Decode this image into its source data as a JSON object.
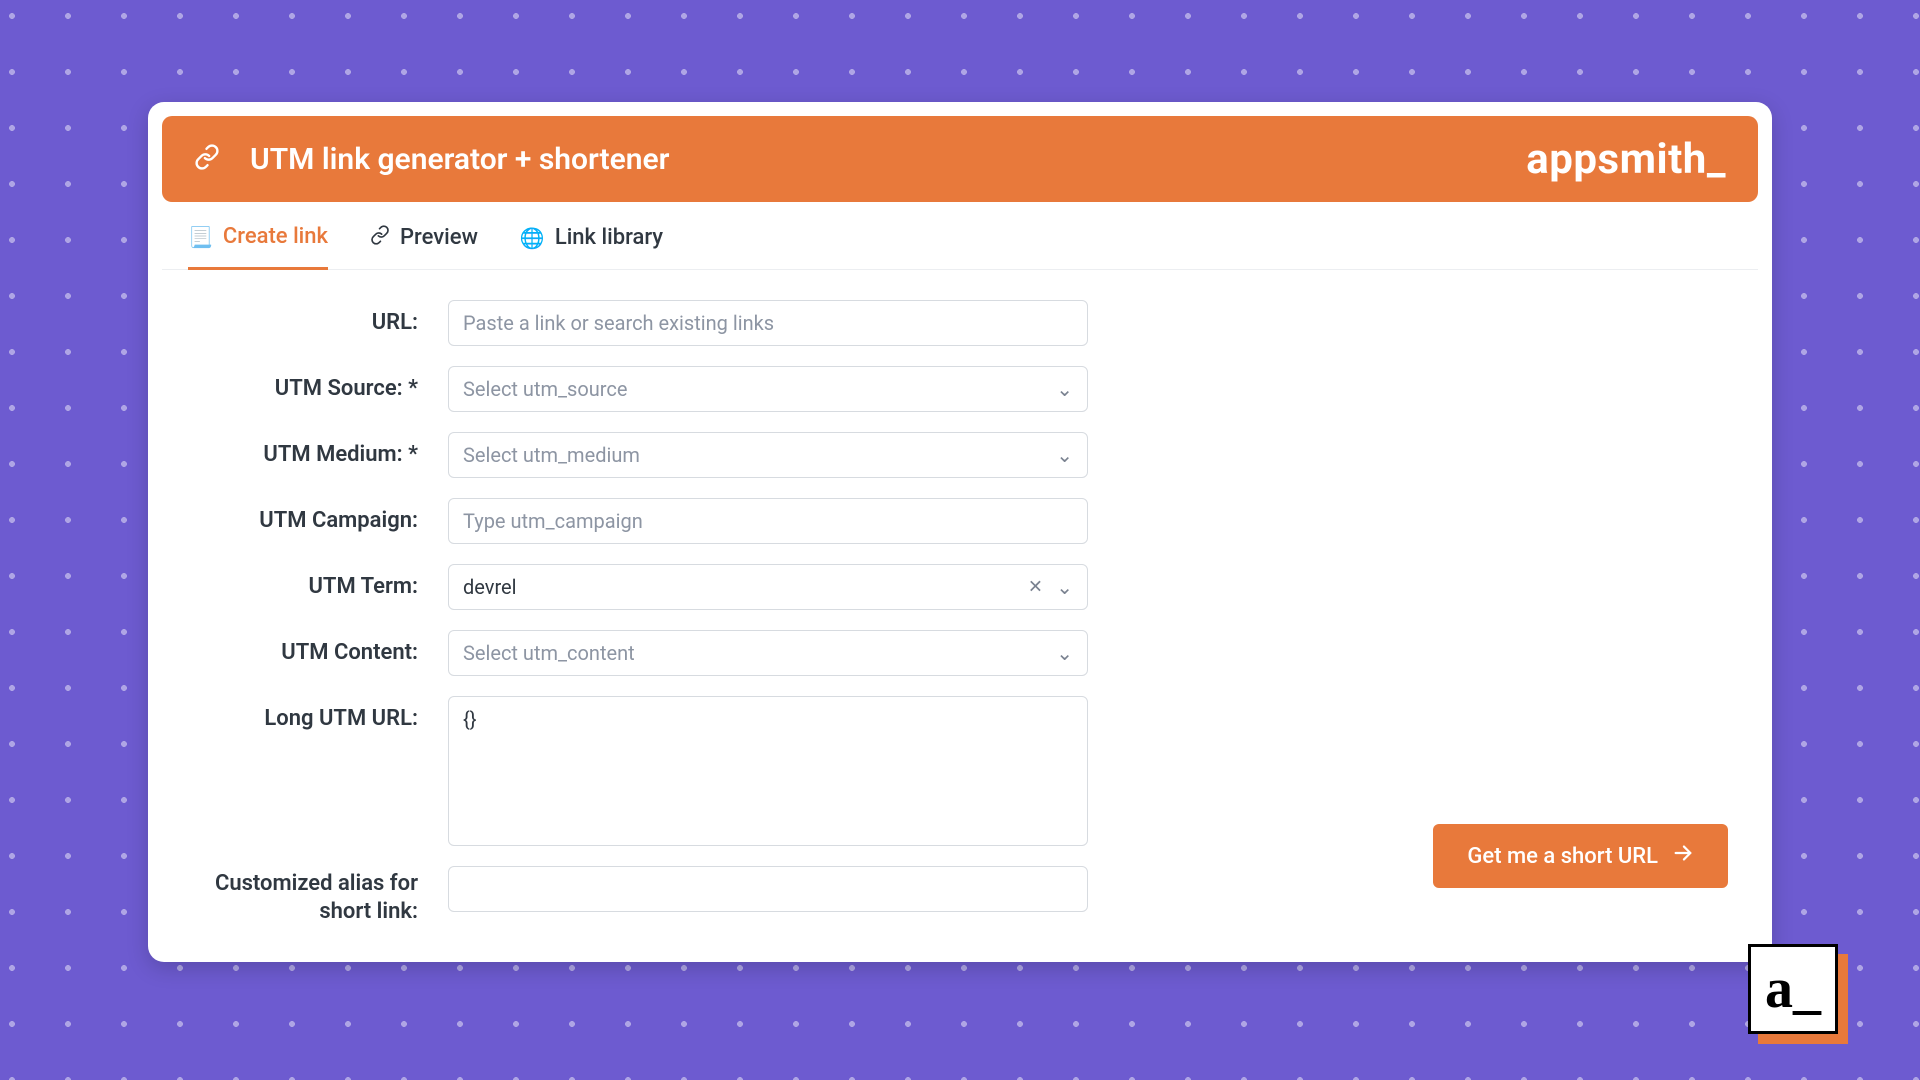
{
  "header": {
    "title": "UTM link generator + shortener",
    "brand": "appsmith_"
  },
  "tabs": [
    {
      "label": "Create link",
      "icon": "📃",
      "active": true
    },
    {
      "label": "Preview",
      "icon": "link",
      "active": false
    },
    {
      "label": "Link library",
      "icon": "🌐",
      "active": false
    }
  ],
  "form": {
    "url": {
      "label": "URL:",
      "placeholder": "Paste a link or search existing links",
      "value": ""
    },
    "source": {
      "label": "UTM Source: *",
      "placeholder": "Select utm_source",
      "value": ""
    },
    "medium": {
      "label": "UTM Medium: *",
      "placeholder": "Select utm_medium",
      "value": ""
    },
    "campaign": {
      "label": "UTM Campaign:",
      "placeholder": "Type utm_campaign",
      "value": ""
    },
    "term": {
      "label": "UTM Term:",
      "placeholder": "",
      "value": "devrel"
    },
    "content": {
      "label": "UTM Content:",
      "placeholder": "Select utm_content",
      "value": ""
    },
    "long_url": {
      "label": "Long UTM URL:",
      "value": "{}"
    },
    "alias": {
      "label": "Customized alias for short link:",
      "value": ""
    }
  },
  "cta": {
    "label": "Get me a short URL"
  },
  "corner_logo": "a_",
  "colors": {
    "accent": "#E8793B",
    "bg": "#6D5BD0"
  }
}
